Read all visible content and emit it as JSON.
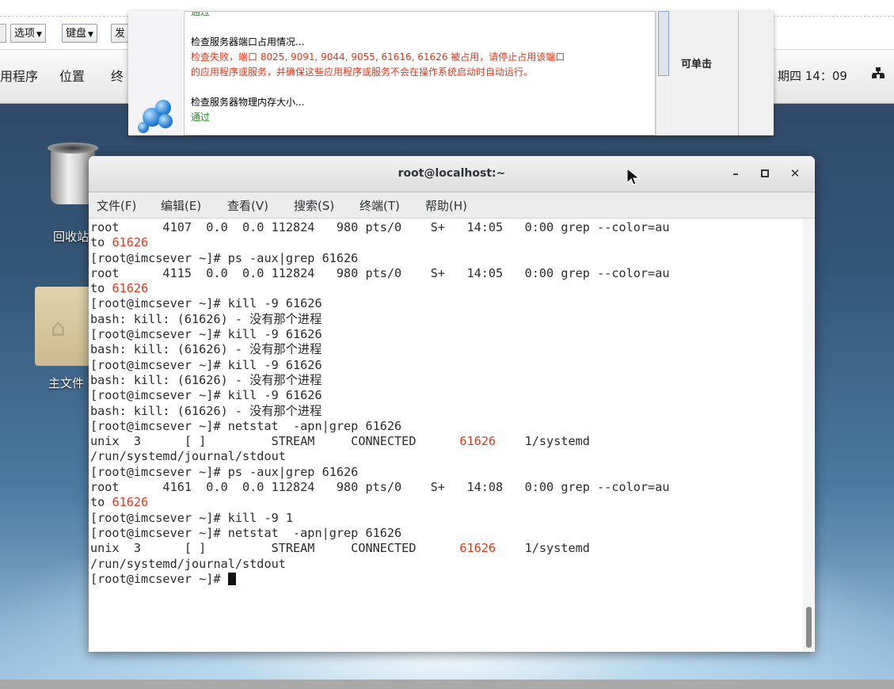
{
  "vnc_toolbar": {
    "options_label": "选项",
    "keyboard_label": "键盘",
    "send_label": "发"
  },
  "top_panel": {
    "applications": "用程序",
    "places": "位置",
    "terminal": "终",
    "clock": "期四 14：09"
  },
  "desktop": {
    "trash_label": "回收站",
    "home_label": "主文件"
  },
  "installer": {
    "log": [
      {
        "text": "通过",
        "status": "ok"
      },
      {
        "text": "",
        "status": ""
      },
      {
        "text": "检查服务器端口占用情况...",
        "status": ""
      },
      {
        "text": "检查失败，端口 8025, 9091, 9044, 9055, 61616, 61626 被占用，请停止占用该端口",
        "status": "fail"
      },
      {
        "text": "的应用程序或服务，并确保这些应用程序或服务不会在操作系统启动时自动运行。",
        "status": "fail"
      },
      {
        "text": "",
        "status": ""
      },
      {
        "text": "检查服务器物理内存大小...",
        "status": ""
      },
      {
        "text": "通过",
        "status": "ok"
      }
    ],
    "side_label": "可单击"
  },
  "terminal": {
    "title": "root@localhost:~",
    "menu": [
      "文件(F)",
      "编辑(E)",
      "查看(V)",
      "搜索(S)",
      "终端(T)",
      "帮助(H)"
    ],
    "lines": [
      [
        {
          "t": "root      4107  0.0  0.0 112824   980 pts/0    S+   14:05   0:00 grep --color=au"
        }
      ],
      [
        {
          "t": "to "
        },
        {
          "t": "61626",
          "c": "red"
        }
      ],
      [
        {
          "t": "[root@imcsever ~]# ps -aux|grep 61626"
        }
      ],
      [
        {
          "t": "root      4115  0.0  0.0 112824   980 pts/0    S+   14:05   0:00 grep --color=au"
        }
      ],
      [
        {
          "t": "to "
        },
        {
          "t": "61626",
          "c": "red"
        }
      ],
      [
        {
          "t": "[root@imcsever ~]# kill -9 61626"
        }
      ],
      [
        {
          "t": "bash: kill: (61626) - 没有那个进程"
        }
      ],
      [
        {
          "t": "[root@imcsever ~]# kill -9 61626"
        }
      ],
      [
        {
          "t": "bash: kill: (61626) - 没有那个进程"
        }
      ],
      [
        {
          "t": "[root@imcsever ~]# kill -9 61626"
        }
      ],
      [
        {
          "t": "bash: kill: (61626) - 没有那个进程"
        }
      ],
      [
        {
          "t": "[root@imcsever ~]# kill -9 61626"
        }
      ],
      [
        {
          "t": "bash: kill: (61626) - 没有那个进程"
        }
      ],
      [
        {
          "t": "[root@imcsever ~]# netstat  -apn|grep 61626"
        }
      ],
      [
        {
          "t": "unix  3      [ ]         STREAM     CONNECTED      "
        },
        {
          "t": "61626",
          "c": "red"
        },
        {
          "t": "    1/systemd"
        }
      ],
      [
        {
          "t": "/run/systemd/journal/stdout"
        }
      ],
      [
        {
          "t": "[root@imcsever ~]# ps -aux|grep 61626"
        }
      ],
      [
        {
          "t": "root      4161  0.0  0.0 112824   980 pts/0    S+   14:08   0:00 grep --color=au"
        }
      ],
      [
        {
          "t": "to "
        },
        {
          "t": "61626",
          "c": "red"
        }
      ],
      [
        {
          "t": "[root@imcsever ~]# kill -9 1"
        }
      ],
      [
        {
          "t": "[root@imcsever ~]# netstat  -apn|grep 61626"
        }
      ],
      [
        {
          "t": "unix  3      [ ]         STREAM     CONNECTED      "
        },
        {
          "t": "61626",
          "c": "red"
        },
        {
          "t": "    1/systemd"
        }
      ],
      [
        {
          "t": "/run/systemd/journal/stdout"
        }
      ],
      [
        {
          "t": "[root@imcsever ~]# "
        },
        {
          "t": "",
          "c": "cursor"
        }
      ]
    ]
  },
  "icons": {
    "dropdown": "chevron-down-icon",
    "minimize": "minimize-icon",
    "maximize": "maximize-icon",
    "close": "close-icon",
    "network": "network-icon",
    "trash": "trash-icon",
    "home_folder": "home-folder-icon",
    "installer_logo": "installer-logo-icon",
    "mouse": "mouse-pointer-icon"
  },
  "colors": {
    "error_text": "#e0381b",
    "ok_text": "#1a8f1a"
  }
}
